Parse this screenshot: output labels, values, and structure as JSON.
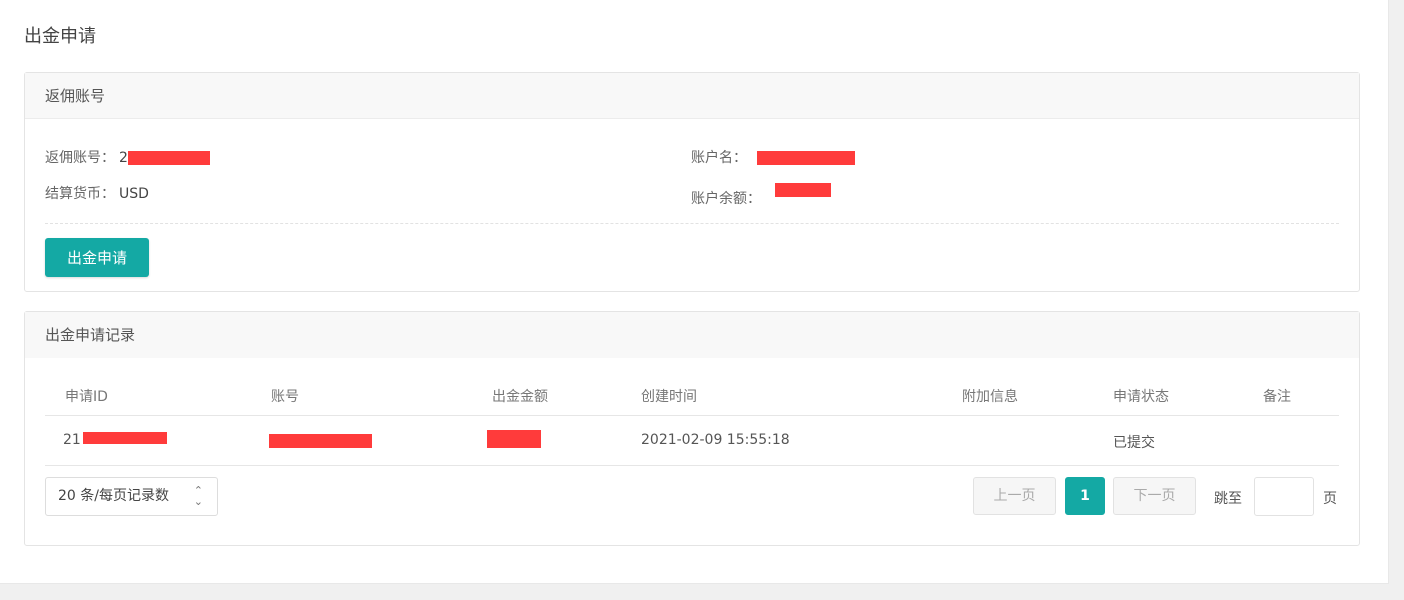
{
  "page": {
    "title": "出金申请"
  },
  "account_card": {
    "header": "返佣账号",
    "rebate_account_label": "返佣账号：",
    "rebate_account_value": "2",
    "account_name_label": "账户名：",
    "currency_label": "结算货币：",
    "currency_value": "USD",
    "balance_label": "账户余额：",
    "apply_button": "出金申请"
  },
  "records_card": {
    "header": "出金申请记录",
    "columns": [
      "申请ID",
      "账号",
      "出金金额",
      "创建时间",
      "附加信息",
      "申请状态",
      "备注"
    ],
    "rows": [
      {
        "id": "21",
        "account": "",
        "amount": "",
        "created": "2021-02-09 15:55:18",
        "extra": "",
        "status": "已提交",
        "remark": ""
      }
    ]
  },
  "pagination": {
    "page_size": "20 条/每页记录数",
    "prev": "上一页",
    "current": "1",
    "next": "下一页",
    "jump_label": "跳至",
    "page_unit": "页",
    "jump_value": ""
  },
  "colors": {
    "accent": "#14a9a4",
    "redaction": "#ff3b3b"
  }
}
